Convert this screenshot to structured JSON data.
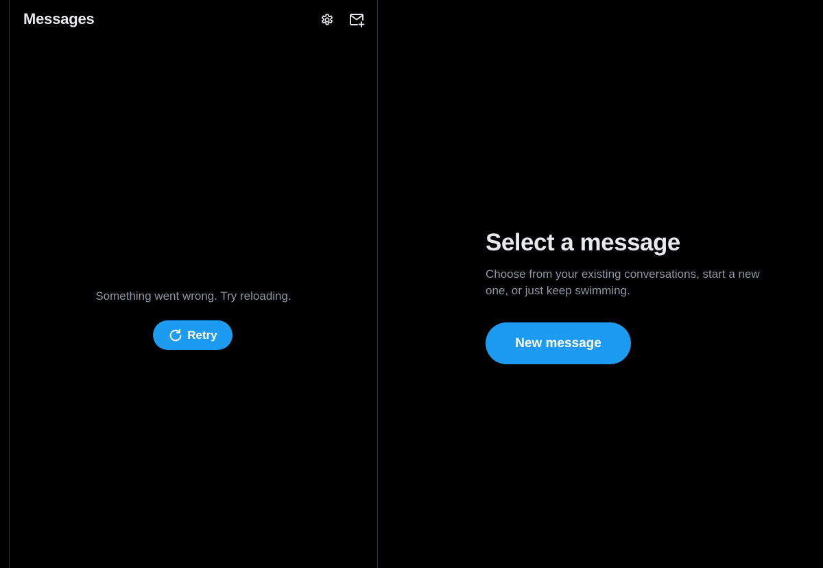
{
  "left_panel": {
    "title": "Messages",
    "icons": {
      "settings": "gear-icon",
      "compose": "mail-plus-icon"
    },
    "error_text": "Something went wrong. Try reloading.",
    "retry_label": "Retry"
  },
  "right_panel": {
    "title": "Select a message",
    "description": "Choose from your existing conversations, start a new one, or just keep swimming.",
    "new_message_label": "New message"
  },
  "colors": {
    "background": "#000000",
    "accent": "#1d9bf0",
    "primary_text": "#e7e9ea",
    "secondary_text": "#8b98a5",
    "border": "#2f3336"
  }
}
